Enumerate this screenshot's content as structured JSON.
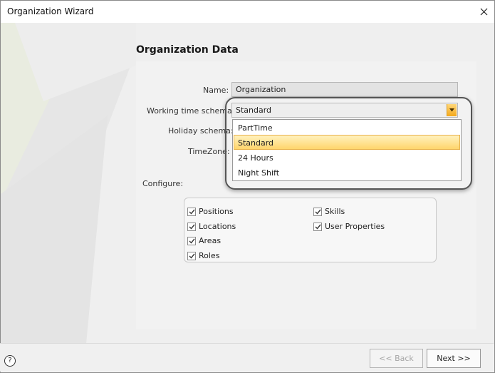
{
  "window": {
    "title": "Organization Wizard"
  },
  "heading": "Organization Data",
  "form": {
    "name_label": "Name:",
    "name_value": "Organization",
    "working_time_label": "Working time schema:",
    "working_time_value": "Standard",
    "holiday_label": "Holiday schema:",
    "timezone_label": "TimeZone:",
    "configure_label": "Configure:"
  },
  "dropdown": {
    "options": [
      "PartTime",
      "Standard",
      "24 Hours",
      "Night Shift"
    ],
    "selected": "Standard"
  },
  "configure": {
    "positions": "Positions",
    "locations": "Locations",
    "areas": "Areas",
    "roles": "Roles",
    "skills": "Skills",
    "user_properties": "User Properties"
  },
  "footer": {
    "help": "?",
    "back": "<< Back",
    "next": "Next >>"
  },
  "colors": {
    "highlight_top": "#fff2bf",
    "highlight_bottom": "#ffd56c",
    "dropdown_button": "#f3a81a"
  },
  "icons": {
    "close": "close-icon",
    "dropdown": "chevron-down-icon",
    "checkbox": "checkmark-icon",
    "help": "help-icon"
  }
}
